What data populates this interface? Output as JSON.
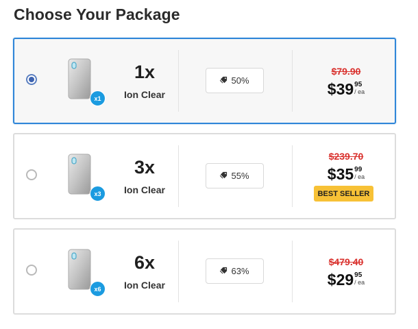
{
  "page_title": "Choose Your Package",
  "packages": [
    {
      "selected": true,
      "quantity": "1x",
      "badge": "x1",
      "product": "Ion Clear",
      "discount": "50%",
      "old_price": "$79.90",
      "price_whole": "$39",
      "price_cents": "95",
      "price_unit": "/ ea",
      "label": ""
    },
    {
      "selected": false,
      "quantity": "3x",
      "badge": "x3",
      "product": "Ion Clear",
      "discount": "55%",
      "old_price": "$239.70",
      "price_whole": "$35",
      "price_cents": "99",
      "price_unit": "/ ea",
      "label": "BEST SELLER"
    },
    {
      "selected": false,
      "quantity": "6x",
      "badge": "x6",
      "product": "Ion Clear",
      "discount": "63%",
      "old_price": "$479.40",
      "price_whole": "$29",
      "price_cents": "95",
      "price_unit": "/ ea",
      "label": ""
    }
  ],
  "colors": {
    "selected_border": "#2f86d8",
    "old_price": "#d9302c",
    "badge": "#1b9be0",
    "best_seller": "#f7c136"
  },
  "icons": {
    "tag": "tag-icon",
    "device": "air-purifier-icon"
  }
}
